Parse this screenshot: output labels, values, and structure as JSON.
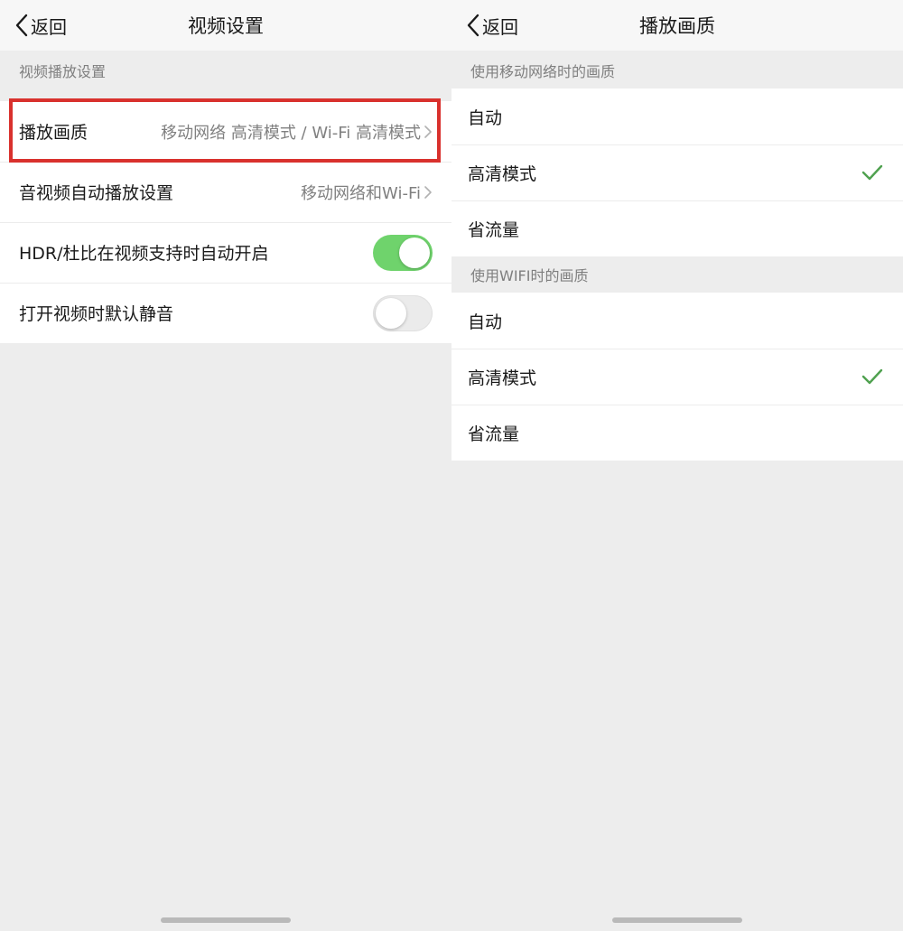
{
  "left": {
    "nav": {
      "back_label": "返回",
      "title": "视频设置"
    },
    "section_header": "视频播放设置",
    "rows": [
      {
        "label": "播放画质",
        "value": "移动网络 高清模式 / Wi-Fi 高清模式"
      },
      {
        "label": "音视频自动播放设置",
        "value": "移动网络和Wi-Fi"
      },
      {
        "label": "HDR/杜比在视频支持时自动开启",
        "toggle": "on"
      },
      {
        "label": "打开视频时默认静音",
        "toggle": "off"
      }
    ]
  },
  "right": {
    "nav": {
      "back_label": "返回",
      "title": "播放画质"
    },
    "mobile_section": {
      "header": "使用移动网络时的画质",
      "options": [
        {
          "label": "自动",
          "selected": false
        },
        {
          "label": "高清模式",
          "selected": true
        },
        {
          "label": "省流量",
          "selected": false
        }
      ]
    },
    "wifi_section": {
      "header": "使用WIFI时的画质",
      "options": [
        {
          "label": "自动",
          "selected": false
        },
        {
          "label": "高清模式",
          "selected": true
        },
        {
          "label": "省流量",
          "selected": false
        }
      ]
    }
  },
  "colors": {
    "accent_green": "#6fd36c",
    "check_green": "#4fa14f",
    "highlight_red": "#d9312d",
    "background": "#ededed"
  },
  "icons": [
    "chevron-left-icon",
    "chevron-right-icon",
    "checkmark-icon"
  ]
}
